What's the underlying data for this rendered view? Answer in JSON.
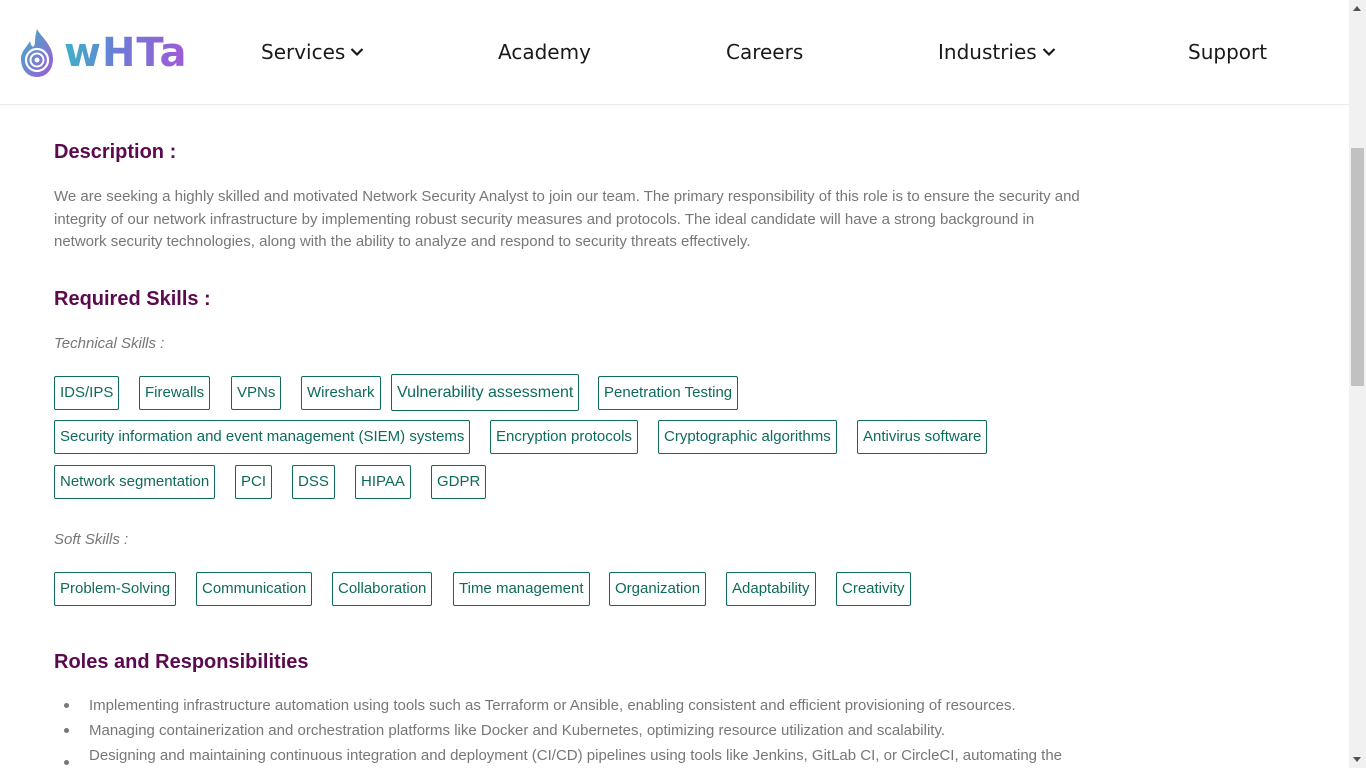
{
  "header": {
    "logo_text": "wHTa",
    "logo_icon": "flame-spiral-logo-icon",
    "nav": {
      "services": "Services",
      "academy": "Academy",
      "careers": "Careers",
      "industries": "Industries",
      "support": "Support"
    }
  },
  "description": {
    "heading": "Description :",
    "text": "We are seeking a highly skilled and motivated Network Security Analyst to join our team. The primary responsibility of this role is to ensure the security and integrity of our network infrastructure by implementing robust security measures and protocols. The ideal candidate will have a strong background in network security technologies, along with the ability to analyze and respond to security threats effectively."
  },
  "skills": {
    "heading": "Required Skills :",
    "technical_label": "Technical Skills :",
    "technical": [
      "IDS/IPS",
      "Firewalls",
      "VPNs",
      "Wireshark",
      "Vulnerability assessment",
      "Penetration Testing",
      "Security information and event management (SIEM) systems",
      "Encryption protocols",
      "Cryptographic algorithms",
      "Antivirus software",
      "Network segmentation",
      "PCI",
      "DSS",
      "HIPAA",
      "GDPR"
    ],
    "soft_label": "Soft Skills :",
    "soft": [
      "Problem-Solving",
      "Communication",
      "Collaboration",
      "Time management",
      "Organization",
      "Adaptability",
      "Creativity"
    ]
  },
  "roles": {
    "heading": "Roles and Responsibilities",
    "items": [
      "Implementing infrastructure automation using tools such as Terraform or Ansible, enabling consistent and efficient provisioning of resources.",
      "Managing containerization and orchestration platforms like Docker and Kubernetes, optimizing resource utilization and scalability.",
      "Designing and maintaining continuous integration and deployment (CI/CD) pipelines using tools like Jenkins, GitLab CI, or CircleCI, automating the"
    ]
  },
  "colors": {
    "heading": "#5b0a4f",
    "tag_border": "#0d6b5a",
    "body_text": "#777777"
  }
}
